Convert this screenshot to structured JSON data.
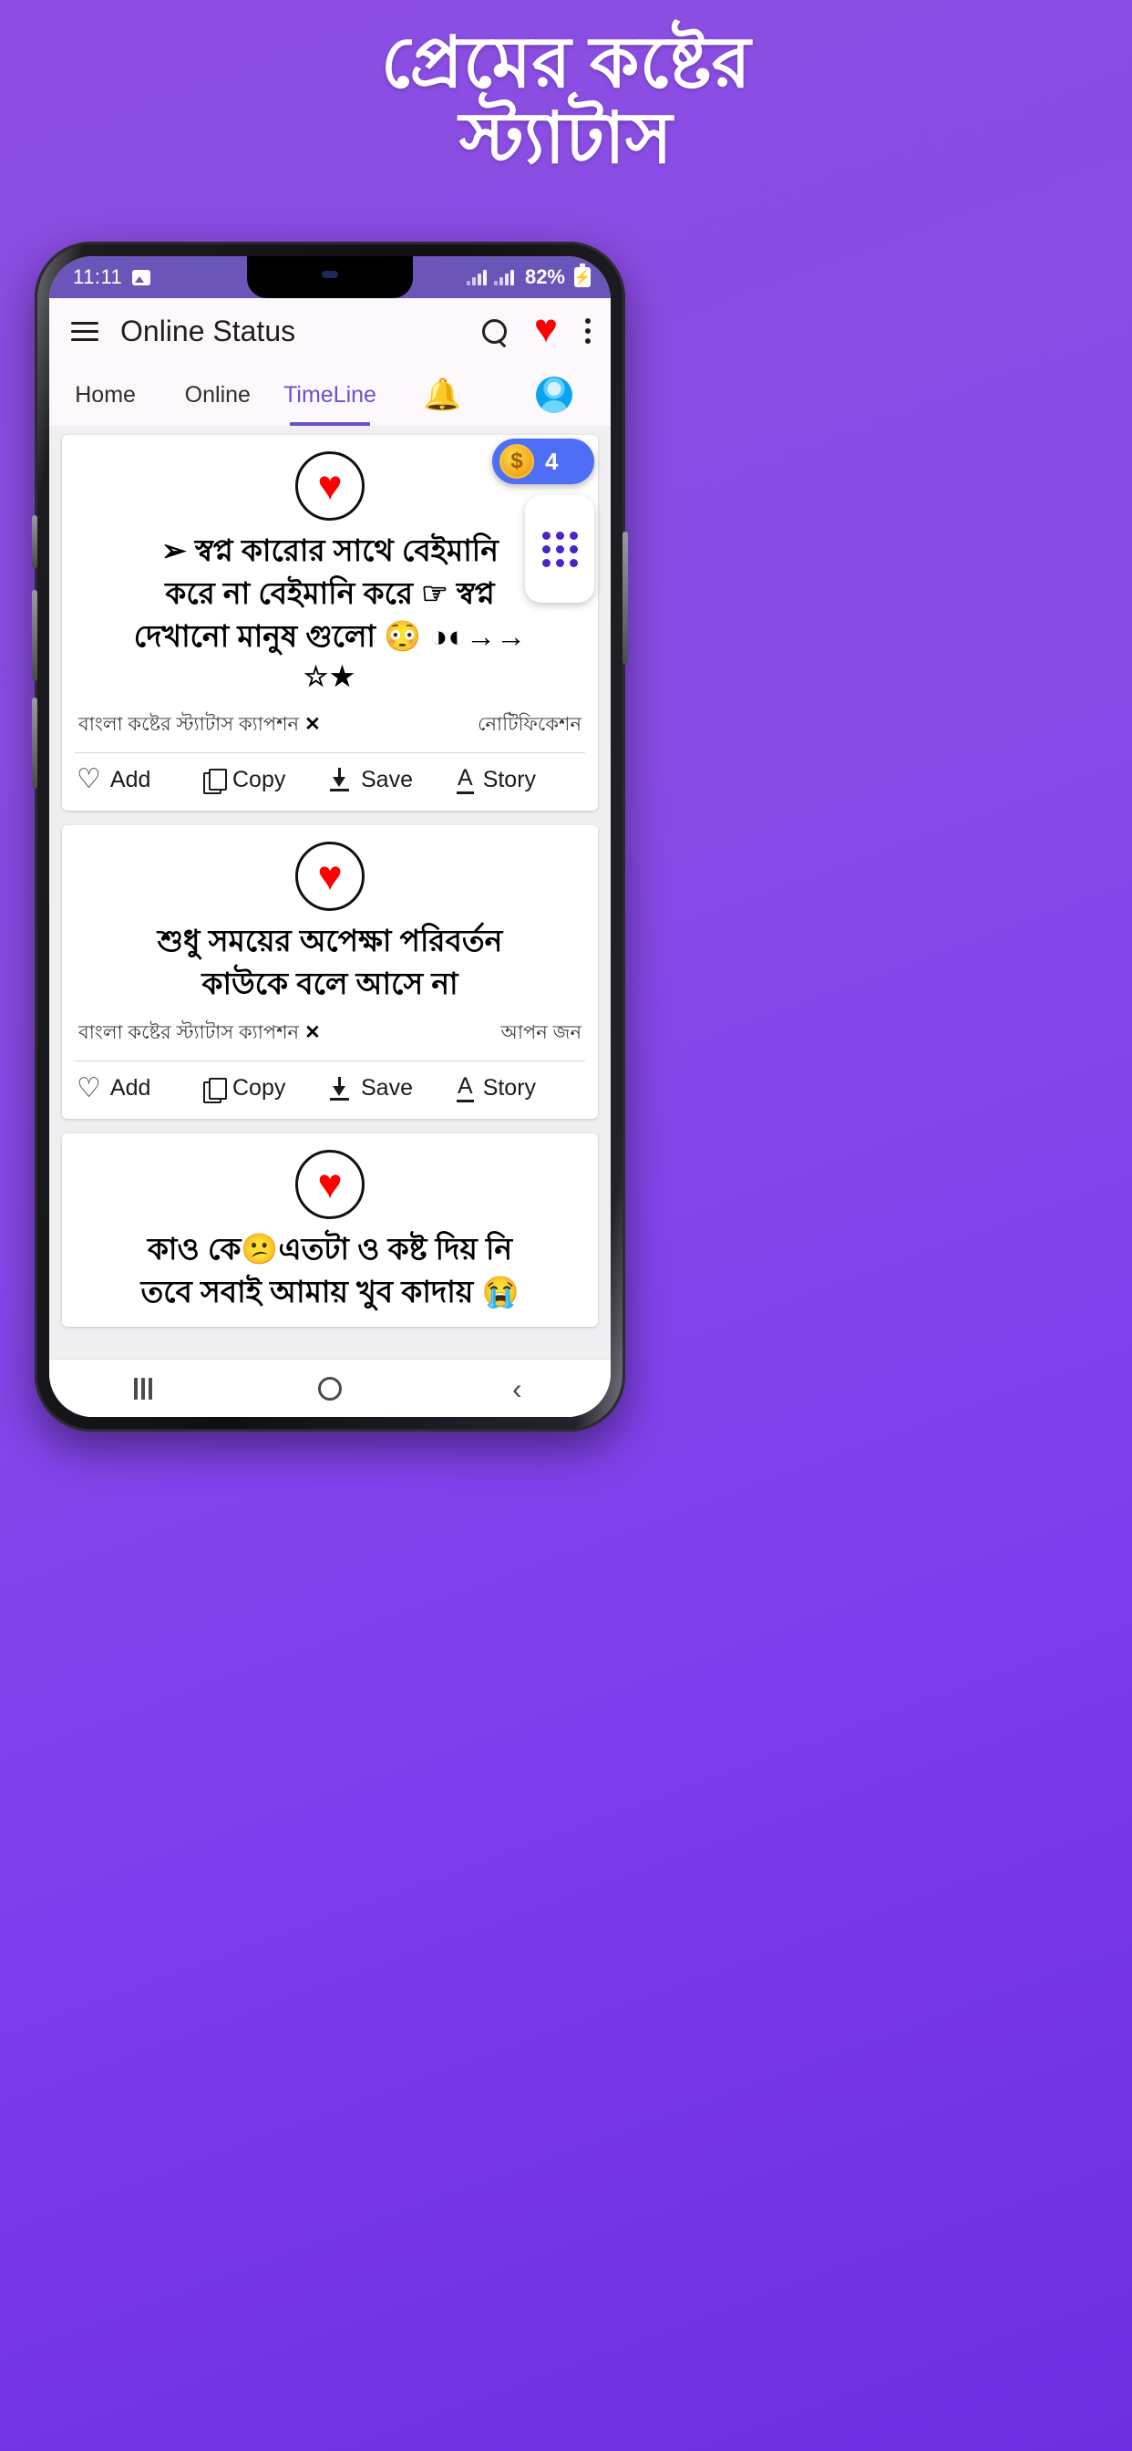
{
  "promo": {
    "title_line1": "প্রেমের কষ্টের",
    "title_line2": "স্ট্যাটাস",
    "background_color": "#8a4ce8"
  },
  "statusbar": {
    "time": "11:11",
    "image_icon": "gallery-icon",
    "battery_percent": "82%",
    "battery_state": "charging",
    "signal_icon": "signal-bars"
  },
  "appbar": {
    "menu_icon": "hamburger-menu-icon",
    "title": "Online Status",
    "search_icon": "search-icon",
    "favorite_icon": "heart-icon",
    "overflow_icon": "more-vertical-icon",
    "favorite_color": "#fe0000"
  },
  "tabs": {
    "active_index": 2,
    "active_color": "#6a52cc",
    "items": [
      {
        "label": "Home",
        "type": "text"
      },
      {
        "label": "Online",
        "type": "text"
      },
      {
        "label": "TimeLine",
        "type": "text"
      },
      {
        "label": "🔔",
        "type": "icon",
        "icon": "bell-icon"
      },
      {
        "label": "",
        "type": "avatar",
        "icon": "profile-avatar-icon"
      }
    ]
  },
  "feed": {
    "cards": [
      {
        "icon": "heart-icon",
        "quote_lines": [
          "➢ স্বপ্ন  কারোর সাথে বেইমানি",
          "করে না বেইমানি  করে ☞ স্বপ্ন",
          "দেখানো মানুষ গুলো 😳 ◑◐→→",
          "☆★"
        ],
        "caption": "বাংলা কষ্টের স্ট্যাটাস ক্যাপশন",
        "caption_close": "✕",
        "category": "নোটিফিকেশন",
        "actions": [
          {
            "label": "Add",
            "icon": "heart-outline-icon"
          },
          {
            "label": "Copy",
            "icon": "copy-icon"
          },
          {
            "label": "Save",
            "icon": "download-icon"
          },
          {
            "label": "Story",
            "icon": "text-story-icon"
          }
        ]
      },
      {
        "icon": "heart-icon",
        "quote_lines": [
          "শুধু সময়ের অপেক্ষা পরিবর্তন",
          "কাউকে বলে আসে না"
        ],
        "caption": "বাংলা কষ্টের স্ট্যাটাস ক্যাপশন",
        "caption_close": "✕",
        "category": "আপন জন",
        "actions": [
          {
            "label": "Add",
            "icon": "heart-outline-icon"
          },
          {
            "label": "Copy",
            "icon": "copy-icon"
          },
          {
            "label": "Save",
            "icon": "download-icon"
          },
          {
            "label": "Story",
            "icon": "text-story-icon"
          }
        ]
      },
      {
        "icon": "heart-icon",
        "quote_lines": [
          "কাও কে😕এতটা ও কষ্ট  দিয় নি",
          "তবে সবাই আমায় খুব কাদায় 😭"
        ],
        "caption": "",
        "caption_close": "",
        "category": "",
        "actions": []
      }
    ]
  },
  "overlays": {
    "coin": {
      "icon": "coin-icon",
      "count": "4",
      "background_color": "#4d6ef5"
    },
    "apps_fab": {
      "icon": "apps-grid-icon"
    }
  },
  "navbar": {
    "recents_icon": "recents-icon",
    "home_icon": "home-icon",
    "back_icon": "‹"
  }
}
